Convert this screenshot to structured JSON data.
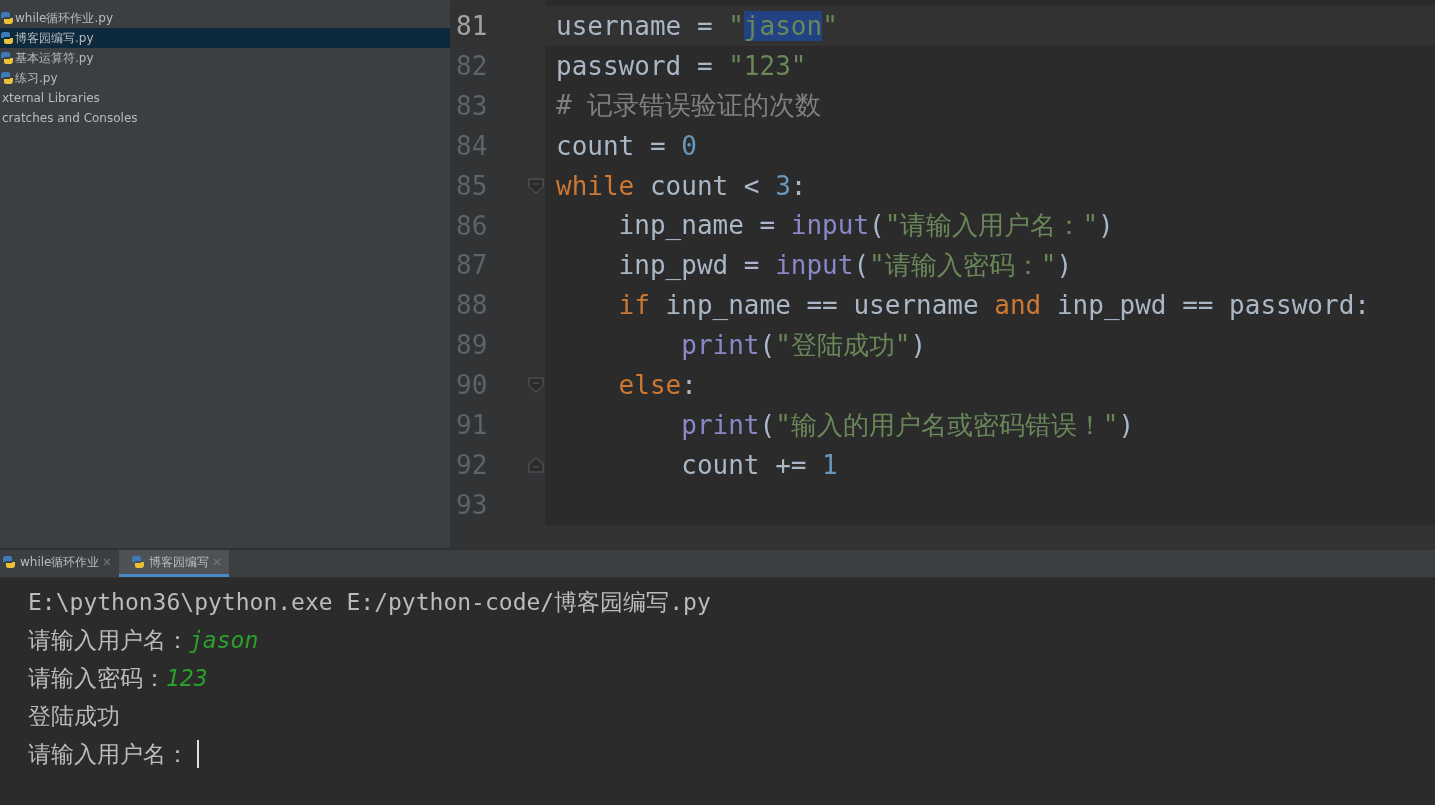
{
  "project_tree": {
    "items": [
      {
        "kind": "file",
        "label": "while循环作业.py",
        "selected": false
      },
      {
        "kind": "file",
        "label": "博客园编写.py",
        "selected": true
      },
      {
        "kind": "file",
        "label": "基本运算符.py",
        "selected": false
      },
      {
        "kind": "file",
        "label": "练习.py",
        "selected": false
      },
      {
        "kind": "folder",
        "label": "xternal Libraries",
        "selected": false
      },
      {
        "kind": "folder",
        "label": "cratches and Consoles",
        "selected": false
      }
    ]
  },
  "editor": {
    "lines": [
      {
        "number": "81",
        "current": true,
        "fold_start": false,
        "fold_end": false,
        "tokens": [
          {
            "kind": "plain",
            "text": "username = "
          },
          {
            "kind": "str",
            "text": "\""
          },
          {
            "kind": "selection",
            "text": "jason"
          },
          {
            "kind": "str",
            "text": "\""
          }
        ]
      },
      {
        "number": "82",
        "current": false,
        "fold_start": false,
        "fold_end": false,
        "tokens": [
          {
            "kind": "plain",
            "text": "password = "
          },
          {
            "kind": "str",
            "text": "\"123\""
          }
        ]
      },
      {
        "number": "83",
        "current": false,
        "fold_start": false,
        "fold_end": false,
        "tokens": [
          {
            "kind": "comment",
            "text": "# 记录错误验证的次数"
          }
        ]
      },
      {
        "number": "84",
        "current": false,
        "fold_start": false,
        "fold_end": false,
        "tokens": [
          {
            "kind": "plain",
            "text": "count = "
          },
          {
            "kind": "num",
            "text": "0"
          }
        ]
      },
      {
        "number": "85",
        "current": false,
        "fold_start": true,
        "fold_end": false,
        "tokens": [
          {
            "kind": "kw",
            "text": "while"
          },
          {
            "kind": "plain",
            "text": " count < "
          },
          {
            "kind": "num",
            "text": "3"
          },
          {
            "kind": "plain",
            "text": ":"
          }
        ]
      },
      {
        "number": "86",
        "current": false,
        "fold_start": false,
        "fold_end": false,
        "tokens": [
          {
            "kind": "plain",
            "text": "    inp_name = "
          },
          {
            "kind": "builtin",
            "text": "input"
          },
          {
            "kind": "plain",
            "text": "("
          },
          {
            "kind": "str",
            "text": "\"请输入用户名：\""
          },
          {
            "kind": "plain",
            "text": ")"
          }
        ]
      },
      {
        "number": "87",
        "current": false,
        "fold_start": false,
        "fold_end": false,
        "tokens": [
          {
            "kind": "plain",
            "text": "    inp_pwd = "
          },
          {
            "kind": "builtin",
            "text": "input"
          },
          {
            "kind": "plain",
            "text": "("
          },
          {
            "kind": "str",
            "text": "\"请输入密码：\""
          },
          {
            "kind": "plain",
            "text": ")"
          }
        ]
      },
      {
        "number": "88",
        "current": false,
        "fold_start": false,
        "fold_end": false,
        "tokens": [
          {
            "kind": "kw",
            "text": "    if"
          },
          {
            "kind": "plain",
            "text": " inp_name == username "
          },
          {
            "kind": "kw",
            "text": "and"
          },
          {
            "kind": "plain",
            "text": " inp_pwd == password:"
          }
        ]
      },
      {
        "number": "89",
        "current": false,
        "fold_start": false,
        "fold_end": false,
        "tokens": [
          {
            "kind": "builtin",
            "text": "        print"
          },
          {
            "kind": "plain",
            "text": "("
          },
          {
            "kind": "str",
            "text": "\"登陆成功\""
          },
          {
            "kind": "plain",
            "text": ")"
          }
        ]
      },
      {
        "number": "90",
        "current": false,
        "fold_start": true,
        "fold_end": false,
        "tokens": [
          {
            "kind": "kw",
            "text": "    else"
          },
          {
            "kind": "plain",
            "text": ":"
          }
        ]
      },
      {
        "number": "91",
        "current": false,
        "fold_start": false,
        "fold_end": false,
        "tokens": [
          {
            "kind": "builtin",
            "text": "        print"
          },
          {
            "kind": "plain",
            "text": "("
          },
          {
            "kind": "str",
            "text": "\"输入的用户名或密码错误！\""
          },
          {
            "kind": "plain",
            "text": ")"
          }
        ]
      },
      {
        "number": "92",
        "current": false,
        "fold_start": false,
        "fold_end": true,
        "tokens": [
          {
            "kind": "plain",
            "text": "        count += "
          },
          {
            "kind": "num",
            "text": "1"
          }
        ]
      },
      {
        "number": "93",
        "current": false,
        "fold_start": false,
        "fold_end": false
      }
    ]
  },
  "run_tabs": [
    {
      "label": "while循环作业",
      "selected": false
    },
    {
      "label": "博客园编写",
      "selected": true
    }
  ],
  "console": {
    "lines": [
      {
        "text": "E:\\python36\\python.exe E:/python-code/博客园编写.py"
      },
      {
        "text": "请输入用户名：",
        "input": "jason"
      },
      {
        "text": "请输入密码：",
        "input": "123"
      },
      {
        "text": "登陆成功"
      },
      {
        "text": "请输入用户名：",
        "cursor": true
      }
    ]
  }
}
